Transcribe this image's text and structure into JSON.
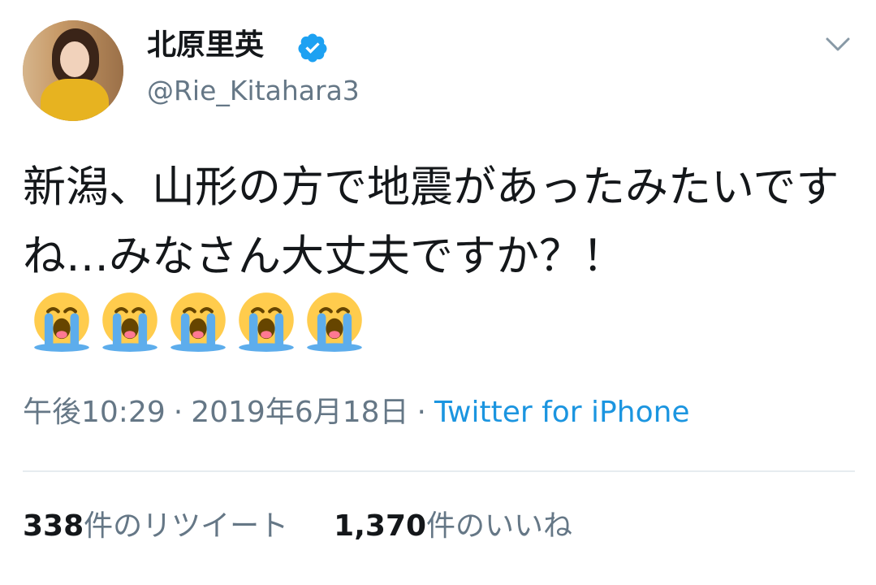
{
  "user": {
    "display_name": "北原里英",
    "handle": "@Rie_Kitahara3",
    "verified_icon": "verified-badge-icon"
  },
  "menu": {
    "icon": "chevron-down-icon"
  },
  "tweet": {
    "text": "新潟、山形の方で地震があったみたいですね…みなさん大丈夫ですか？！",
    "emoji": [
      "loudly-crying-face",
      "loudly-crying-face",
      "loudly-crying-face",
      "loudly-crying-face",
      "loudly-crying-face"
    ]
  },
  "meta": {
    "time": "午後10:29",
    "separator": "·",
    "date": "2019年6月18日",
    "source": "Twitter for iPhone"
  },
  "stats": {
    "retweets_count": "338",
    "retweets_label": "件のリツイート",
    "likes_count": "1,370",
    "likes_label": "件のいいね"
  },
  "colors": {
    "text": "#14171a",
    "secondary": "#657786",
    "link": "#1b95e0",
    "verified": "#1da1f2",
    "divider": "#e6ecf0"
  }
}
